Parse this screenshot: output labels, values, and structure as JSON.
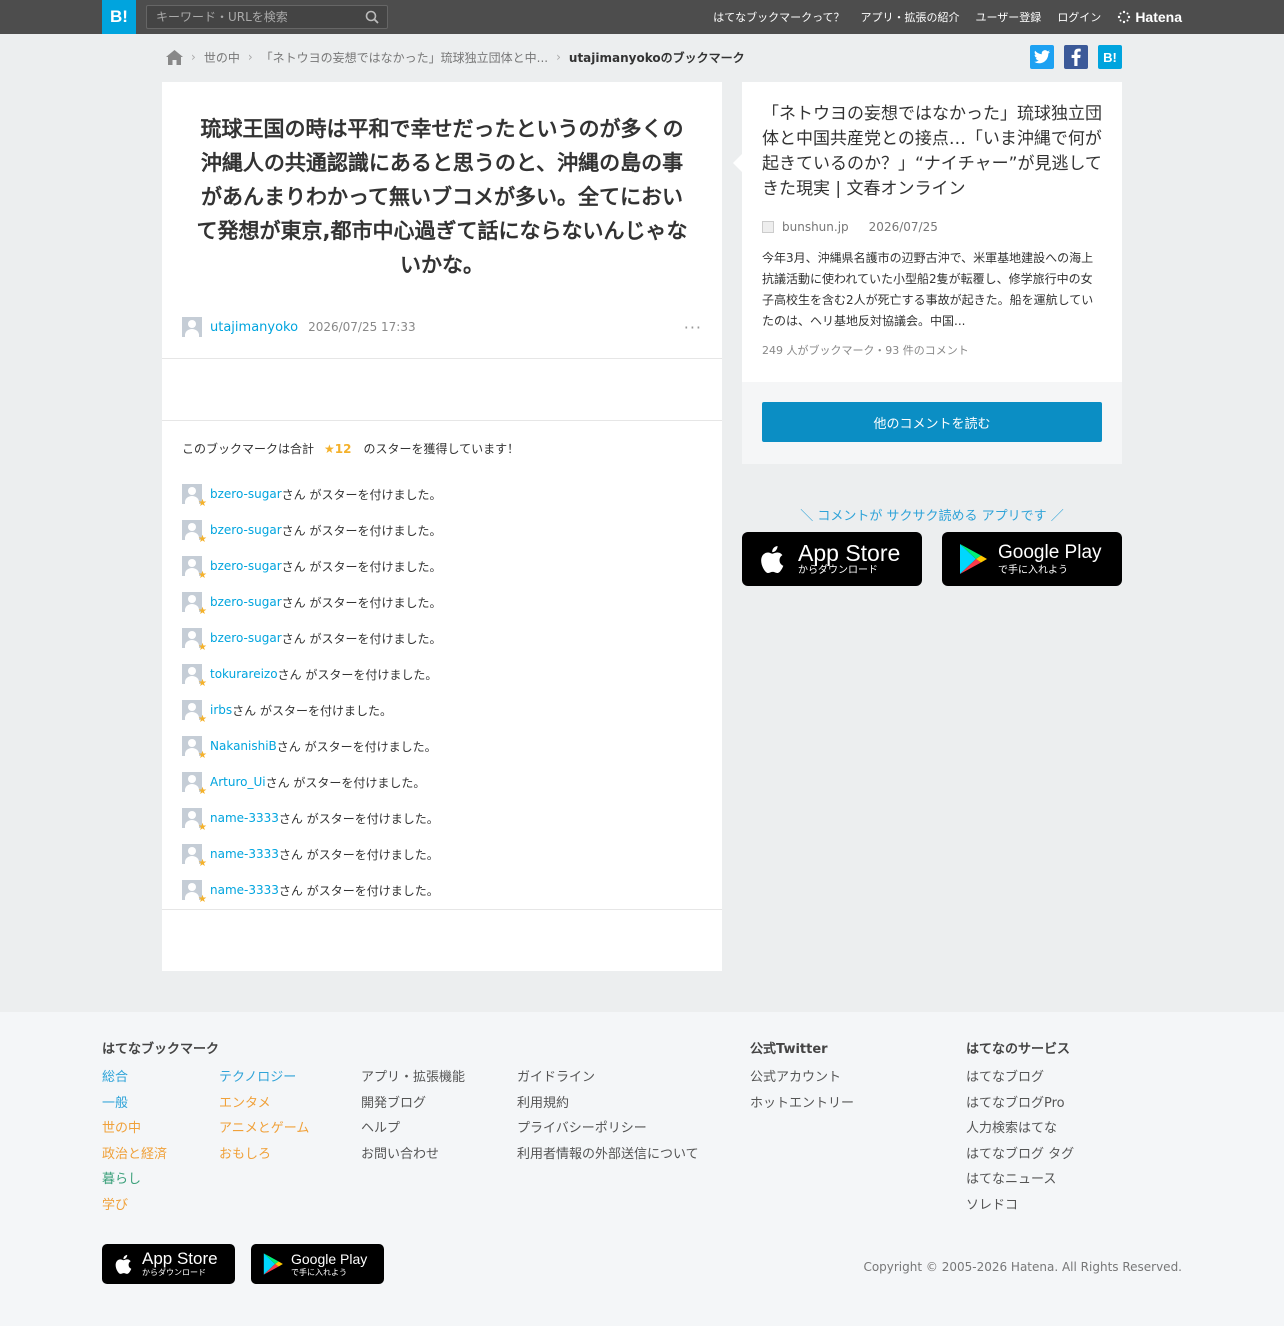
{
  "header": {
    "logo": "B!",
    "search_placeholder": "キーワード・URLを検索",
    "nav": [
      "はてなブックマークって？",
      "アプリ・拡張の紹介",
      "ユーザー登録",
      "ログイン"
    ],
    "brand": "Hatena"
  },
  "breadcrumb": {
    "items": [
      "世の中",
      "「ネトウヨの妄想ではなかった」琉球独立団体と中..."
    ],
    "current": "utajimanyokoのブックマーク"
  },
  "share": {
    "twitter": "t",
    "facebook": "f",
    "hatena": "B!"
  },
  "bookmark": {
    "comment": "琉球王国の時は平和で幸せだったというのが多くの沖縄人の共通認識にあると思うのと、沖縄の島の事があんまりわかって無いブコメが多い。全てにおいて発想が東京,都市中心過ぎて話にならないんじゃないかな。",
    "user": "utajimanyoko",
    "date": "2026/07/25 17:33",
    "more": "···"
  },
  "stars": {
    "summary_prefix": "このブックマークは合計",
    "count": "★12",
    "summary_suffix": "のスターを獲得しています！",
    "suffix_text": "さん がスターを付けました。",
    "items": [
      {
        "user": "bzero-sugar"
      },
      {
        "user": "bzero-sugar"
      },
      {
        "user": "bzero-sugar"
      },
      {
        "user": "bzero-sugar"
      },
      {
        "user": "bzero-sugar"
      },
      {
        "user": "tokurareizo"
      },
      {
        "user": "irbs"
      },
      {
        "user": "NakanishiB"
      },
      {
        "user": "Arturo_Ui"
      },
      {
        "user": "name-3333"
      },
      {
        "user": "name-3333"
      },
      {
        "user": "name-3333"
      }
    ]
  },
  "entry": {
    "title": "「ネトウヨの妄想ではなかった」琉球独立団体と中国共産党との接点…「いま沖縄で何が起きているのか？」“ナイチャー”が見逃してきた現実 | 文春オンライン",
    "domain": "bunshun.jp",
    "date": "2026/07/25",
    "description": "今年3月、沖縄県名護市の辺野古沖で、米軍基地建設への海上抗議活動に使われていた小型船2隻が転覆し、修学旅行中の女子高校生を含む2人が死亡する事故が起きた。船を運航していたのは、ヘリ基地反対協議会。中国...",
    "stats": "249 人がブックマーク・93 件のコメント",
    "read_more": "他のコメントを読む"
  },
  "app_promo": {
    "text": "＼ コメントが サクサク読める アプリです ／",
    "appstore_main": "App Store",
    "appstore_sub": "からダウンロード",
    "googleplay_main": "Google Play",
    "googleplay_sub": "で手に入れよう"
  },
  "footer": {
    "col1_title": "はてなブックマーク",
    "categories_a": [
      "総合",
      "一般",
      "世の中",
      "政治と経済",
      "暮らし",
      "学び"
    ],
    "categories_b": [
      "テクノロジー",
      "エンタメ",
      "アニメとゲーム",
      "おもしろ"
    ],
    "links_a": [
      "アプリ・拡張機能",
      "開発ブログ",
      "ヘルプ",
      "お問い合わせ"
    ],
    "links_b": [
      "ガイドライン",
      "利用規約",
      "プライバシーポリシー",
      "利用者情報の外部送信について"
    ],
    "col_twitter_title": "公式Twitter",
    "twitter_links": [
      "公式アカウント",
      "ホットエントリー"
    ],
    "col_services_title": "はてなのサービス",
    "services": [
      "はてなブログ",
      "はてなブログPro",
      "人力検索はてな",
      "はてなブログ タグ",
      "はてなニュース",
      "ソレドコ"
    ],
    "copyright": "Copyright © 2005-2026 Hatena. All Rights Reserved."
  }
}
